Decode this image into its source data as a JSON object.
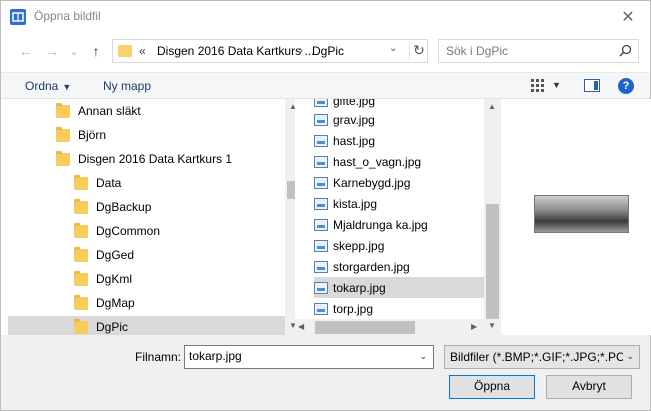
{
  "window": {
    "title": "Öppna bildfil",
    "close_glyph": "✕"
  },
  "nav": {
    "back_glyph": "←",
    "forward_glyph": "→",
    "recent_glyph": "⌄",
    "up_glyph": "↑",
    "address": {
      "start": "«",
      "segment1": "Disgen 2016 Data Kartkurs ...",
      "separator": "›",
      "segment2": "DgPic",
      "dropdown_glyph": "⌄",
      "refresh_glyph": "↻"
    },
    "search_placeholder": "Sök i DgPic"
  },
  "toolbar": {
    "organize_label": "Ordna",
    "organize_caret": "▼",
    "new_folder_label": "Ny mapp",
    "view_dropdown_glyph": "▼",
    "help_glyph": "?"
  },
  "tree": {
    "items": [
      {
        "label": "Annan släkt"
      },
      {
        "label": "Björn"
      },
      {
        "label": "Disgen 2016 Data Kartkurs 1"
      },
      {
        "label": "Data"
      },
      {
        "label": "DgBackup"
      },
      {
        "label": "DgCommon"
      },
      {
        "label": "DgGed"
      },
      {
        "label": "DgKml"
      },
      {
        "label": "DgMap"
      },
      {
        "label": "DgPic"
      }
    ],
    "selected_index": 9
  },
  "files": {
    "items": [
      {
        "label": "gifte.jpg"
      },
      {
        "label": "grav.jpg"
      },
      {
        "label": "hast.jpg"
      },
      {
        "label": "hast_o_vagn.jpg"
      },
      {
        "label": "Karnebygd.jpg"
      },
      {
        "label": "kista.jpg"
      },
      {
        "label": "Mjaldrunga ka.jpg"
      },
      {
        "label": "skepp.jpg"
      },
      {
        "label": "storgarden.jpg"
      },
      {
        "label": "tokarp.jpg"
      },
      {
        "label": "torp.jpg"
      }
    ],
    "selected_index": 9
  },
  "scroll_arrows": {
    "up": "▲",
    "down": "▼",
    "left": "◀",
    "right": "▶"
  },
  "bottom": {
    "filename_label": "Filnamn:",
    "filename_value": "tokarp.jpg",
    "filename_dropdown_glyph": "⌄",
    "filter_text": "Bildfiler (*.BMP;*.GIF;*.JPG;*.PC",
    "filter_dropdown_glyph": "⌄",
    "open_label": "Öppna",
    "cancel_label": "Avbryt"
  }
}
